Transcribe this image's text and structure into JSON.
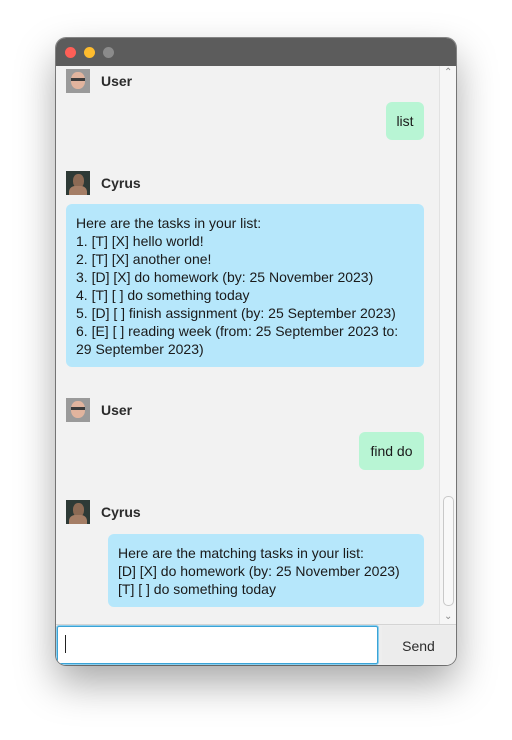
{
  "colors": {
    "titlebar": "#5c5c5c",
    "user_bubble": "#b8f5d4",
    "bot_bubble": "#b6e7fb",
    "chat_background": "#f2f2f2"
  },
  "messages": [
    {
      "sender": "User",
      "text": [
        "list"
      ]
    },
    {
      "sender": "Cyrus",
      "text": [
        "Here are the tasks in your list:",
        "1. [T] [X] hello world!",
        "2. [T] [X] another one!",
        "3. [D] [X] do homework (by: 25 November 2023)",
        "4. [T] [ ] do something today",
        "5. [D] [ ] finish assignment (by: 25 September 2023)",
        "6. [E] [ ] reading week (from: 25 September 2023 to:",
        "29 September 2023)"
      ]
    },
    {
      "sender": "User",
      "text": [
        "find do"
      ]
    },
    {
      "sender": "Cyrus",
      "text": [
        "Here are the matching tasks in your list:",
        "[D] [X] do homework (by: 25 November 2023)",
        "[T] [ ] do something today"
      ]
    }
  ],
  "input": {
    "value": "",
    "placeholder": ""
  },
  "send_label": "Send"
}
